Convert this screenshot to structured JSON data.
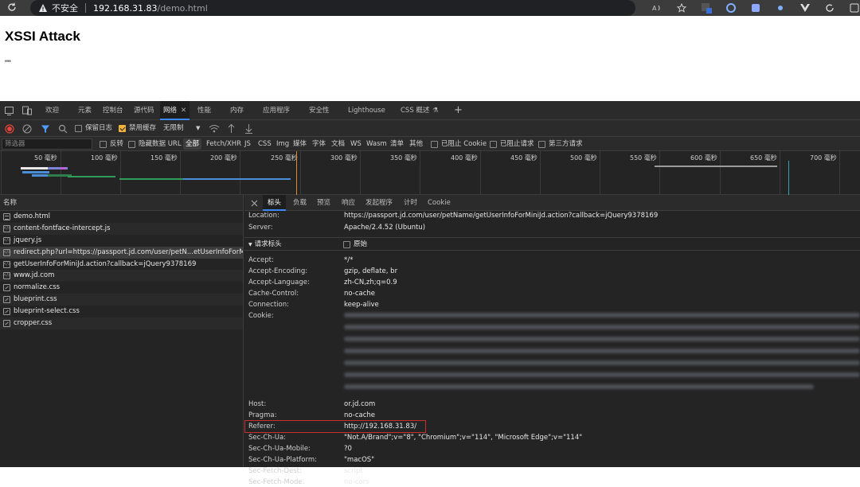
{
  "browser": {
    "insecure_label": "不安全",
    "url_host": "192.168.31.83",
    "url_path": "/demo.html"
  },
  "page": {
    "heading": "XSSI Attack",
    "output_text": "\"\""
  },
  "devtools": {
    "tabs": [
      "欢迎",
      "元素",
      "控制台",
      "源代码",
      "网络",
      "性能",
      "内存",
      "应用程序",
      "安全性",
      "Lighthouse",
      "CSS 概述"
    ],
    "active_tab": "网络",
    "toolbar": {
      "preserve_log": "保留日志",
      "disable_cache": "禁用缓存",
      "throttle": "无限制"
    },
    "filter": {
      "placeholder": "筛选器",
      "invert": "反转",
      "hide_data_urls": "隐藏数据 URL",
      "types": [
        "全部",
        "Fetch/XHR",
        "JS",
        "CSS",
        "Img",
        "媒体",
        "字体",
        "文档",
        "WS",
        "Wasm",
        "清单",
        "其他"
      ],
      "blocked_cookies": "已阻止 Cookie",
      "blocked_requests": "已阻止请求",
      "third_party": "第三方请求"
    },
    "timeline_ticks": [
      "50 毫秒",
      "100 毫秒",
      "150 毫秒",
      "200 毫秒",
      "250 毫秒",
      "300 毫秒",
      "350 毫秒",
      "400 毫秒",
      "450 毫秒",
      "500 毫秒",
      "550 毫秒",
      "600 毫秒",
      "650 毫秒",
      "700 毫秒"
    ],
    "requests_header": "名称",
    "requests": [
      "demo.html",
      "content-fontface-intercept.js",
      "jquery.js",
      "redirect.php?url=https://passport.jd.com/user/petN...etUserInfoForMiniJd...",
      "getUserInfoForMiniJd.action?callback=jQuery9378169",
      "www.jd.com",
      "normalize.css",
      "blueprint.css",
      "blueprint-select.css",
      "cropper.css"
    ],
    "detail_tabs": [
      "标头",
      "负载",
      "预览",
      "响应",
      "发起程序",
      "计时",
      "Cookie"
    ],
    "response_headers": [
      {
        "key": "Location:",
        "value": "https://passport.jd.com/user/petName/getUserInfoForMiniJd.action?callback=jQuery9378169"
      },
      {
        "key": "Server:",
        "value": "Apache/2.4.52 (Ubuntu)"
      }
    ],
    "request_headers_title": "请求标头",
    "raw_label": "原始",
    "request_headers": [
      {
        "key": "Accept:",
        "value": "*/*"
      },
      {
        "key": "Accept-Encoding:",
        "value": "gzip, deflate, br"
      },
      {
        "key": "Accept-Language:",
        "value": "zh-CN,zh;q=0.9"
      },
      {
        "key": "Cache-Control:",
        "value": "no-cache"
      },
      {
        "key": "Connection:",
        "value": "keep-alive"
      },
      {
        "key": "Cookie:",
        "value": ""
      }
    ],
    "request_headers_after": [
      {
        "key": "Host:",
        "value": "or.jd.com"
      },
      {
        "key": "Pragma:",
        "value": "no-cache"
      },
      {
        "key": "Referer:",
        "value": "http://192.168.31.83/"
      },
      {
        "key": "Sec-Ch-Ua:",
        "value": "\"Not.A/Brand\";v=\"8\", \"Chromium\";v=\"114\", \"Microsoft Edge\";v=\"114\""
      },
      {
        "key": "Sec-Ch-Ua-Mobile:",
        "value": "?0"
      },
      {
        "key": "Sec-Ch-Ua-Platform:",
        "value": "\"macOS\""
      },
      {
        "key": "Sec-Fetch-Dest:",
        "value": "script"
      },
      {
        "key": "Sec-Fetch-Mode:",
        "value": "no-cors"
      }
    ]
  }
}
